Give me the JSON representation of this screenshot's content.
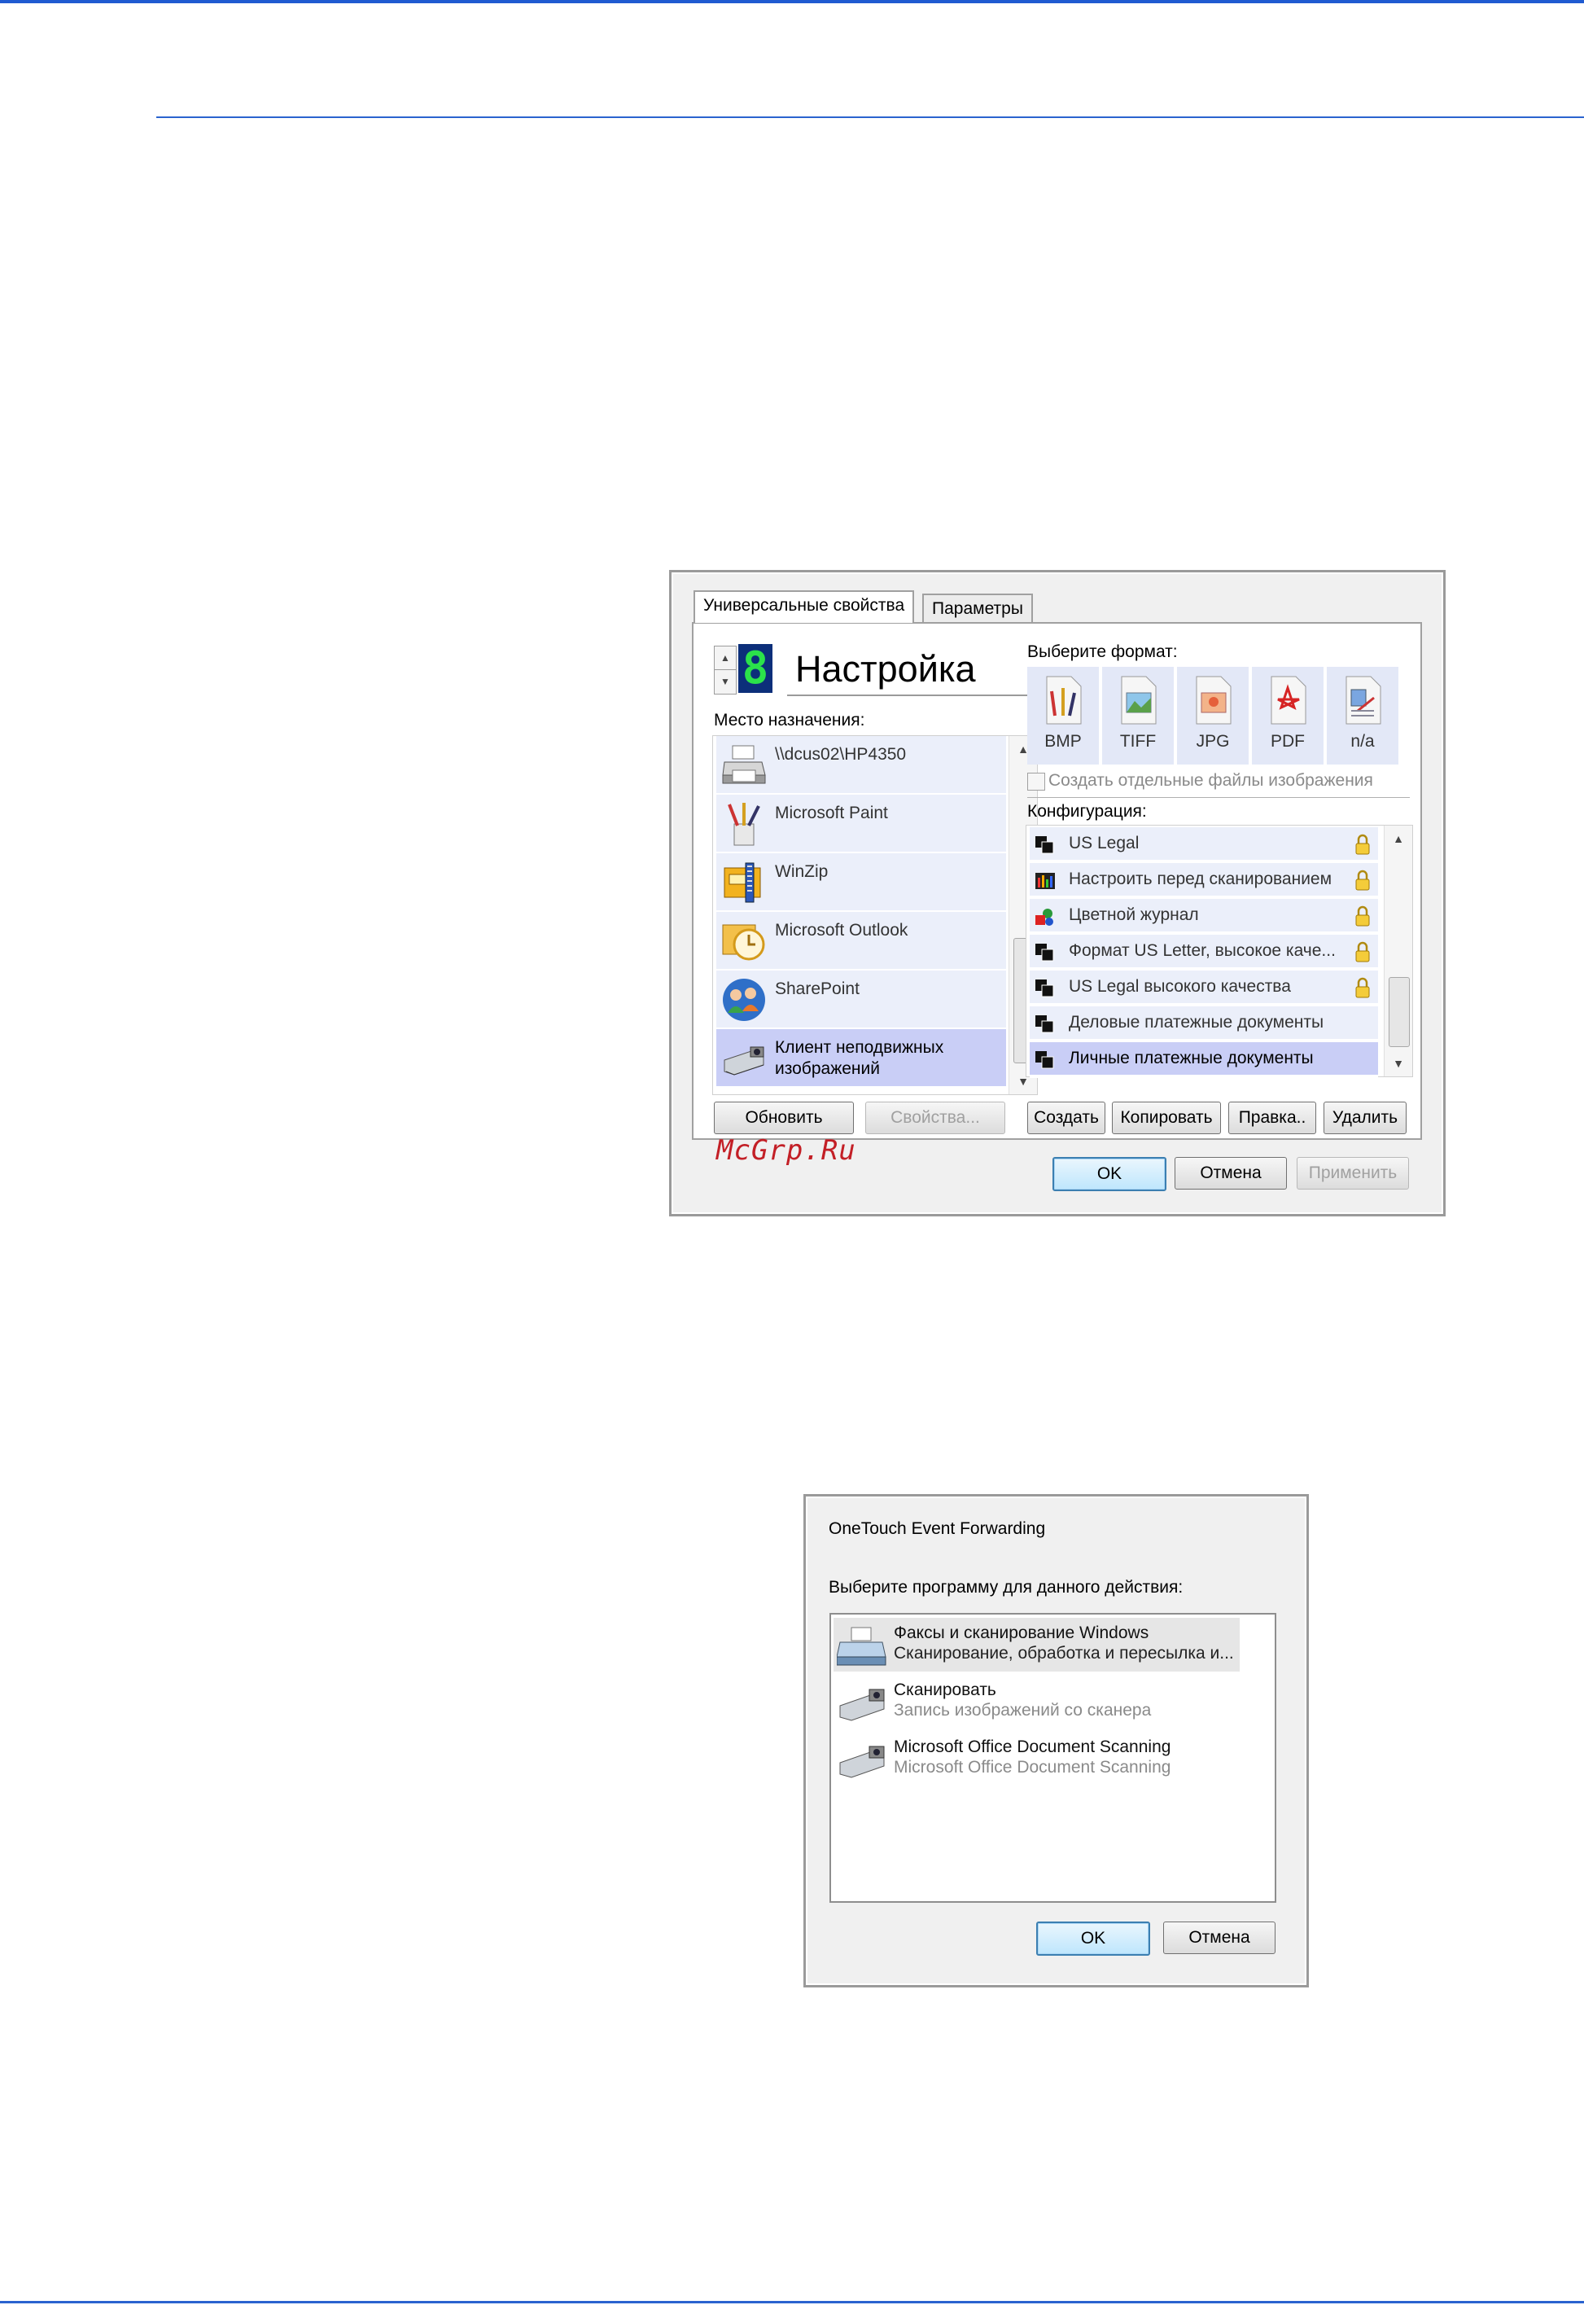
{
  "dialog1": {
    "tabs": [
      "Универсальные свойства",
      "Параметры"
    ],
    "profile": {
      "digit": "8",
      "name": "Настройка"
    },
    "destination_label": "Место назначения:",
    "destinations": [
      {
        "label": "\\\\dcus02\\HP4350",
        "icon": "printer-icon"
      },
      {
        "label": "Microsoft Paint",
        "icon": "paint-icon"
      },
      {
        "label": "WinZip",
        "icon": "winzip-icon"
      },
      {
        "label": "Microsoft Outlook",
        "icon": "outlook-icon"
      },
      {
        "label": "SharePoint",
        "icon": "sharepoint-icon"
      },
      {
        "label": "Клиент неподвижных\nизображений",
        "icon": "camera-scanner-icon",
        "selected": true
      }
    ],
    "buttons_left": {
      "refresh": "Обновить",
      "properties": "Свойства..."
    },
    "format_label": "Выберите формат:",
    "formats": [
      {
        "label": "BMP",
        "icon": "bmp-file-icon"
      },
      {
        "label": "TIFF",
        "icon": "tiff-file-icon"
      },
      {
        "label": "JPG",
        "icon": "jpg-file-icon"
      },
      {
        "label": "PDF",
        "icon": "pdf-file-icon"
      },
      {
        "label": "n/a",
        "icon": "na-file-icon"
      }
    ],
    "separate_files_checkbox": "Создать отдельные файлы изображения",
    "config_label": "Конфигурация:",
    "configs": [
      {
        "label": "US Legal",
        "icon": "bw-document-icon",
        "locked": true
      },
      {
        "label": "Настроить перед сканированием",
        "icon": "color-bars-icon",
        "locked": true
      },
      {
        "label": "Цветной журнал",
        "icon": "color-shapes-icon",
        "locked": true
      },
      {
        "label": "Формат US Letter, высокое каче...",
        "icon": "bw-document-icon",
        "locked": true
      },
      {
        "label": "US Legal высокого качества",
        "icon": "bw-document-icon",
        "locked": true
      },
      {
        "label": "Деловые платежные документы",
        "icon": "bw-document-icon",
        "locked": false
      },
      {
        "label": "Личные платежные документы",
        "icon": "bw-document-icon",
        "locked": false,
        "selected": true
      }
    ],
    "buttons_right": {
      "create": "Создать",
      "copy": "Копировать",
      "edit": "Правка..",
      "delete": "Удалить"
    },
    "footer": {
      "ok": "OK",
      "cancel": "Отмена",
      "apply": "Применить"
    },
    "watermark": "McGrp.Ru"
  },
  "dialog2": {
    "title": "OneTouch Event Forwarding",
    "prompt": "Выберите программу для данного действия:",
    "programs": [
      {
        "name": "Факсы и сканирование Windows",
        "desc": "Сканирование, обработка и пересылка и...",
        "icon": "fax-scanner-icon",
        "selected": true
      },
      {
        "name": "Сканировать",
        "desc": "Запись изображений со сканера",
        "icon": "camera-scanner-icon"
      },
      {
        "name": "Microsoft Office Document Scanning",
        "desc": "Microsoft Office Document Scanning",
        "icon": "camera-scanner-icon"
      }
    ],
    "ok": "OK",
    "cancel": "Отмена"
  }
}
